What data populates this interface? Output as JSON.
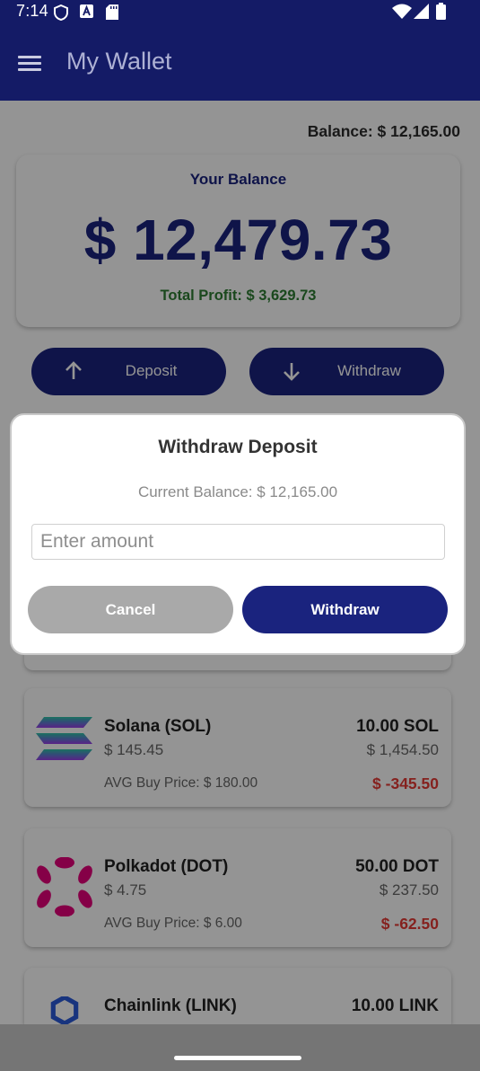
{
  "status_bar": {
    "time": "7:14",
    "icons": [
      "shield-icon",
      "a-badge-icon",
      "sd-card-icon",
      "wifi-icon",
      "signal-icon",
      "battery-icon"
    ]
  },
  "app_bar": {
    "title": "My Wallet",
    "menu_icon": "hamburger-menu-icon",
    "background": "#141b66"
  },
  "summary": {
    "balance_text": "Balance: $ 12,165.00"
  },
  "balance_card": {
    "label": "Your Balance",
    "amount": "$ 12,479.73",
    "profit": "Total Profit: $ 3,629.73"
  },
  "actions": {
    "deposit_label": "Deposit",
    "deposit_icon": "arrow-up-icon",
    "withdraw_label": "Withdraw",
    "withdraw_icon": "arrow-down-icon"
  },
  "assets": [
    {
      "name": "Solana (SOL)",
      "price": "$ 145.45",
      "avg_buy": "AVG Buy Price: $ 180.00",
      "quantity": "10.00 SOL",
      "value": "$ 1,454.50",
      "profit_loss": "$ -345.50",
      "logo": "solana-logo-icon"
    },
    {
      "name": "Polkadot (DOT)",
      "price": "$ 4.75",
      "avg_buy": "AVG Buy Price: $ 6.00",
      "quantity": "50.00 DOT",
      "value": "$ 237.50",
      "profit_loss": "$ -62.50",
      "logo": "polkadot-logo-icon"
    },
    {
      "name": "Chainlink (LINK)",
      "quantity": "10.00 LINK",
      "logo": "chainlink-logo-icon"
    }
  ],
  "dialog": {
    "title": "Withdraw Deposit",
    "current_balance": "Current Balance: $ 12,165.00",
    "amount_placeholder": "Enter amount",
    "amount_value": "",
    "cancel_label": "Cancel",
    "confirm_label": "Withdraw"
  },
  "colors": {
    "primary": "#1a237e",
    "profit_green": "#2e7d32",
    "loss_red": "#e53935",
    "cancel_gray": "#a9a9a9"
  }
}
